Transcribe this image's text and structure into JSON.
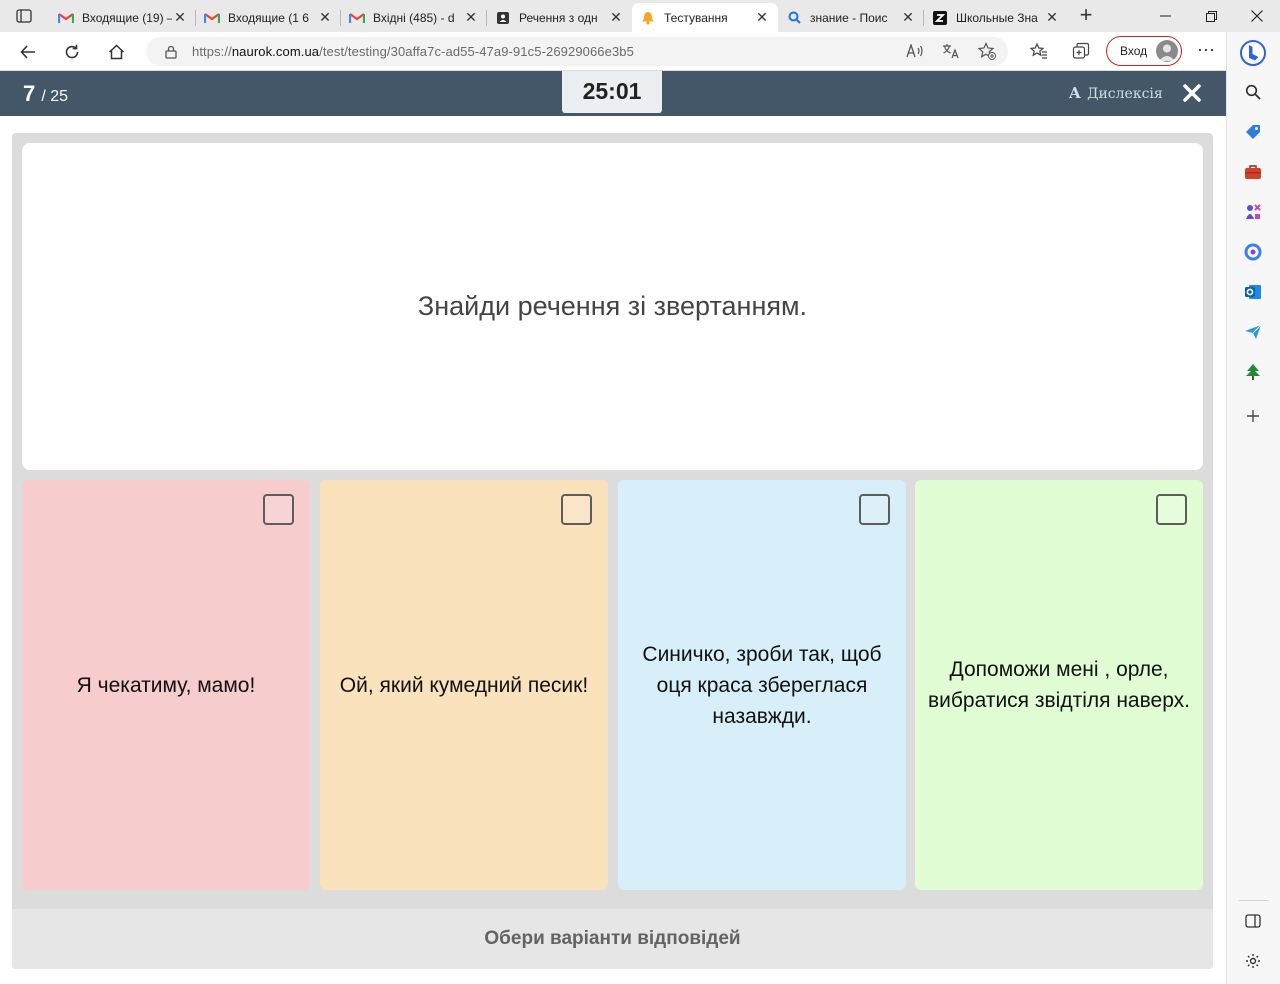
{
  "browser": {
    "tabs": [
      {
        "title": "Входящие (19) –",
        "icon": "gmail-icon",
        "active": false
      },
      {
        "title": "Входящие (1 6",
        "icon": "gmail-icon",
        "active": false
      },
      {
        "title": "Вхідні (485) - d",
        "icon": "gmail-icon",
        "active": false
      },
      {
        "title": "Речення з одн",
        "icon": "contact-card-icon",
        "active": false
      },
      {
        "title": "Тестування",
        "icon": "naurok-bell-icon",
        "active": true
      },
      {
        "title": "знание - Поис",
        "icon": "search-icon",
        "active": false
      },
      {
        "title": "Школьные Зна",
        "icon": "znanija-icon",
        "active": false
      }
    ],
    "url_prefix": "https://",
    "url_host": "naurok.com.ua",
    "url_path": "/test/testing/30affa7c-ad55-47a9-91c5-26929066e3b5",
    "login_label": "Вход",
    "accent_color": "#c42b1c"
  },
  "test": {
    "current": "7",
    "total": "/ 25",
    "timer": "25:01",
    "dyslexia_icon": "A",
    "dyslexia_label": "Дислексія",
    "header_color": "#435768"
  },
  "question": {
    "text": "Знайди речення зі звертанням."
  },
  "options": [
    {
      "text": "Я чекатиму, мамо!",
      "color": "#f6cccd",
      "checked": false
    },
    {
      "text": "Ой, який кумедний песик!",
      "color": "#fae2bc",
      "checked": false
    },
    {
      "text": "Синичко, зроби так, щоб оця краса збереглася назавжди.",
      "color": "#d8eef9",
      "checked": false
    },
    {
      "text": "Допоможи мені , орле, вибратися звідтіля наверх.",
      "color": "#e1fdd3",
      "checked": false
    }
  ],
  "footer": {
    "label": "Обери варіанти відповідей"
  }
}
